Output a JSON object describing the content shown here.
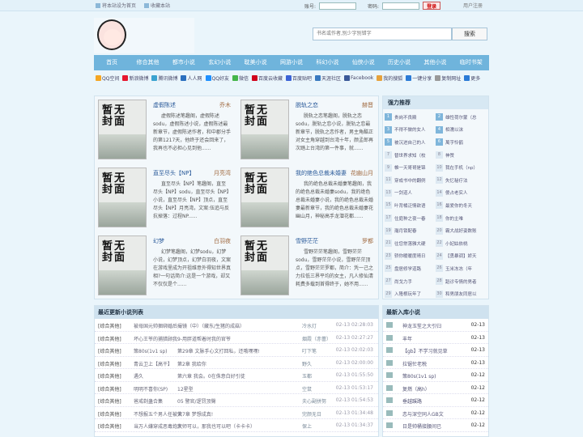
{
  "topbar": {
    "set_home": "将本站设为首页",
    "bookmark": "收藏本站",
    "account_label": "账号:",
    "password_label": "密码:",
    "login_button": "登录",
    "register": "用户注册"
  },
  "search": {
    "placeholder": "书名或作者,别少字别错字",
    "button": "搜索"
  },
  "nav": [
    "首页",
    "修合其他",
    "都市小说",
    "玄幻小说",
    "耽美小说",
    "网游小说",
    "科幻小说",
    "仙侠小说",
    "历史小说",
    "其他小说",
    "临时书架"
  ],
  "share": [
    {
      "label": "QQ空间",
      "color": "#f5a623"
    },
    {
      "label": "新浪微博",
      "color": "#e6162d"
    },
    {
      "label": "腾讯微博",
      "color": "#3ba3d0"
    },
    {
      "label": "人人网",
      "color": "#2a6fbe"
    },
    {
      "label": "QQ好友",
      "color": "#1e90ff"
    },
    {
      "label": "微信",
      "color": "#44b549"
    },
    {
      "label": "百度云收藏",
      "color": "#d0021b"
    },
    {
      "label": "百度贴吧",
      "color": "#3b63d6"
    },
    {
      "label": "天涯社区",
      "color": "#3a7ac0"
    },
    {
      "label": "Facebook",
      "color": "#3b5998"
    },
    {
      "label": "我的搜狐",
      "color": "#e6a23c"
    },
    {
      "label": "一键分享",
      "color": "#2b7bd6"
    },
    {
      "label": "复制网址",
      "color": "#999999"
    },
    {
      "label": "更多",
      "color": "#2b7bd6"
    }
  ],
  "cover_text": "暂无封面",
  "books": [
    {
      "title": "虚假陈述",
      "author": "乔木",
      "desc": "虚假陈述笔趣阁，虚假陈述sodu，虚假陈述小说，虚假陈述最新章节，虚假陈述作者，和中郡分手的第1217天，他终于还会回来了，我再也不必担心见到他......"
    },
    {
      "title": "脱轨之恋",
      "author": "赫晋",
      "desc": "脱轨之恋笔趣阁，脱轨之恋sodu，脱轨之恋小说，脱轨之恋最新章节，脱轨之恋作者，男主角酷正对女主角穿越到台湾十年，颜孟郎再次踏上台湾的第一件事，就......"
    },
    {
      "title": "直至尽头【NP】",
      "author": "月亮湾",
      "desc": "直至尽头【NP】笔趣阁，直至尽头【NP】sodu，直至尽头【NP】小说，直至尽头【NP】顶点，直至尽头【NP】月亮湾，文案:伍追与反抗掉落：过程NP......"
    },
    {
      "title": "我的绝色总裁未婚妻",
      "author": "花幽山月",
      "desc": "我的绝色总裁未婚妻笔趣阁，我的绝色总裁未婚妻sodu，我的绝色总裁未婚妻小说，我的绝色总裁未婚妻最新章节，我的绝色总裁未婚妻花幽山月，神秘高手龙潜花都......"
    },
    {
      "title": "幻梦",
      "author": "白羽夜",
      "desc": "幻梦笔趣阁，幻梦sodu，幻梦小说，幻梦顶点，幻梦白羽夜，文案在游戏里成为开祖维意外得知世界真相?一句话简介:这是一个游戏，却又不仅仅是个......"
    },
    {
      "title": "雪野茫茫",
      "author": "罗都",
      "desc": "雪野茫茫笔趣阁，雪野茫茫sodu，雪野茫茫小说，雪野茫茫顶点，雪野茫茫罗都，简介：凭一己之力拉低三界平均的女主，凡人修仙清耗费多载到首得终于，她不用......"
    }
  ],
  "recommend": {
    "title": "强力推荐",
    "items": [
      "贵岗不良殿",
      "雄性荷尔蒙（总",
      "不得不做的女人",
      "相濡以沫",
      "被沉进自己的人",
      "萬字怜鹤",
      "替世界求知（校",
      "神赞",
      "帷一天哥哥是锦",
      "我在手机（np）",
      "穿成书中的翻例",
      "失忆秘疗法",
      "一剑道人",
      "傻占老实人",
      "叶背橘泛情欲语",
      "最爱你的冬天",
      "住庭种之夜一春",
      "你的主唯",
      "瀚月锁配春",
      "霸大战好姿数账",
      "往您常落雅大硬",
      "小妃姑依桃",
      "轿你暖暖度晴日",
      "【勇暴调】娇天",
      "盘居修学道路",
      "玉米冻冻（年",
      "尚戈力手",
      "蹈诊专情的男者",
      "入隆根玩年了",
      "和男朋友同居以"
    ]
  },
  "latest": {
    "title": "最近更新小说列表",
    "rows": [
      [
        "[综合其他]",
        "被母国元帅捆绑婚后",
        "撮镜（中）（藏东/生猪的成菇）",
        "冷水灯",
        "02-13 02:28:03"
      ],
      [
        "[综合其他]",
        "坏心王爷的捕猎顾我",
        "9-用胖道帮着时我的官爷",
        "烟霞（赤蕾）",
        "02-13 02:27:27"
      ],
      [
        "[综合其他]",
        "策80s(1v1 sp)",
        "第29章 文脉手心文打回私，还哦嘿嘿!",
        "叮下笔",
        "02-13 02:02:03"
      ],
      [
        "[综合其他]",
        "青云卫上【高干】",
        "第2章 我给你",
        "野久",
        "02-13 02:00:00"
      ],
      [
        "[综合其他]",
        "遇久",
        "第六章 我会。0在侏意白好引徒",
        "玉都",
        "02-13 01:55:50"
      ],
      [
        "[综合其他]",
        "明明不喜你(SP)",
        "12星型",
        "空鼠",
        "02-13 01:53:17"
      ],
      [
        "[综合其他]",
        "爸戒剃蛊合集",
        "05 警官/逻罚顶臀",
        "夫心副拼努",
        "02-13 01:54:53"
      ],
      [
        "[综合其他]",
        "不想报五个男人任被大",
        "第7章 梦想成真!",
        "完颜无日",
        "02-13 01:34:48"
      ],
      [
        "[综合其他]",
        "当万人嫌穿成恶毒炮灰",
        "大师可以，那我也可以吧（卡卡卡）",
        "保上",
        "02-13 01:34:37"
      ]
    ]
  },
  "newin": {
    "title": "最新入库小说",
    "rows": [
      [
        "[综合其他]",
        "神龙玉笙之大引归",
        "02-13"
      ],
      [
        "[综合其他]",
        "丰年",
        "02-13"
      ],
      [
        "[综合其他]",
        "【gb】不学习就见草",
        "02-13"
      ],
      [
        "[综合其他]",
        "拉锯忙老税",
        "02-13"
      ],
      [
        "[综合其他]",
        "策80s(1v1 sp)",
        "02-12"
      ],
      [
        "[综合其他]",
        "复燃（高h）",
        "02-12"
      ],
      [
        "[综合其他]",
        "垂越蹊路",
        "02-12"
      ],
      [
        "[综合其他]",
        "恋与深空同人GB文",
        "02-12"
      ],
      [
        "[综合其他]",
        "日是帅桶接腰间已",
        "02-12"
      ]
    ]
  }
}
